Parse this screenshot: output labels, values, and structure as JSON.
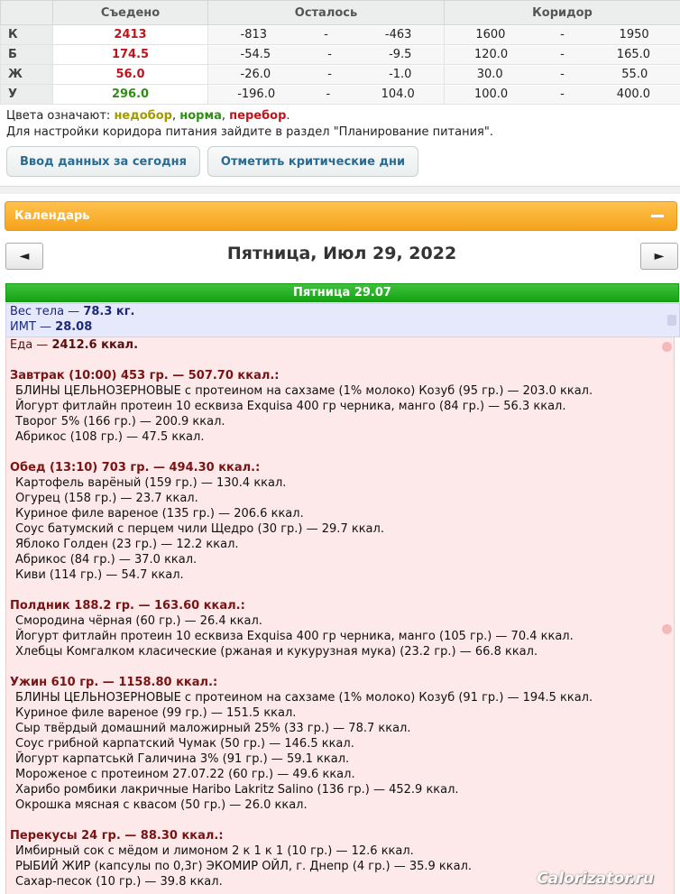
{
  "table": {
    "headers": [
      "",
      "Съедено",
      "Осталось",
      "Коридор"
    ],
    "rows": [
      {
        "label": "К",
        "eaten": "2413",
        "eaten_color": "#c0141c",
        "left_from": "-813",
        "left_to": "-463",
        "corr_from": "1600",
        "corr_to": "1950"
      },
      {
        "label": "Б",
        "eaten": "174.5",
        "eaten_color": "#c0141c",
        "left_from": "-54.5",
        "left_to": "-9.5",
        "corr_from": "120.0",
        "corr_to": "165.0"
      },
      {
        "label": "Ж",
        "eaten": "56.0",
        "eaten_color": "#c0141c",
        "left_from": "-26.0",
        "left_to": "-1.0",
        "corr_from": "30.0",
        "corr_to": "55.0"
      },
      {
        "label": "У",
        "eaten": "296.0",
        "eaten_color": "#2f8f14",
        "left_from": "-196.0",
        "left_to": "104.0",
        "corr_from": "100.0",
        "corr_to": "400.0"
      }
    ],
    "dash": "-"
  },
  "legend": {
    "prefix": "Цвета означают: ",
    "under": "недобор",
    "under_color": "#a39a00",
    "norm": "норма",
    "norm_color": "#2f8f14",
    "over": "перебор",
    "over_color": "#c0141c",
    "comma": ",",
    "dot": ".",
    "note": "Для настройки коридора питания зайдите в раздел \"Планирование питания\"."
  },
  "buttons": {
    "today": "Ввод данных за сегодня",
    "critical": "Отметить критические дни"
  },
  "calendar": {
    "title": "Календарь",
    "date": "Пятница, Июл 29, 2022",
    "prev": "◄",
    "next": "►",
    "day_bar": "Пятница 29.07"
  },
  "body": {
    "weight_label": "Вес тела — ",
    "weight": "78.3 кг.",
    "bmi_label": "ИМТ — ",
    "bmi": "28.08"
  },
  "food": {
    "total_label": "Еда — ",
    "total": "2412.6 ккал.",
    "meals": [
      {
        "title": "Завтрак (10:00) 453 гр. — 507.70 ккал.:",
        "items": [
          "БЛИНЫ ЦЕЛЬНОЗЕРНОВЫЕ с протеином на сахзаме (1% молоко) Козуб (95 гр.) — 203.0 ккал.",
          "Йогурт фитлайн протеин 10 есквиза Exquisa 400 гр черника, манго (84 гр.) — 56.3 ккал.",
          "Творог 5% (166 гр.) — 200.9 ккал.",
          "Абрикос (108 гр.) — 47.5 ккал."
        ]
      },
      {
        "title": "Обед (13:10) 703 гр. — 494.30 ккал.:",
        "items": [
          "Картофель варёный (159 гр.) — 130.4 ккал.",
          "Огурец (158 гр.) — 23.7 ккал.",
          "Куриное филе вареное (135 гр.) — 206.6 ккал.",
          "Соус батумский с перцем чили Щедро (30 гр.) — 29.7 ккал.",
          "Яблоко Голден (23 гр.) — 12.2 ккал.",
          "Абрикос (84 гр.) — 37.0 ккал.",
          "Киви (114 гр.) — 54.7 ккал."
        ]
      },
      {
        "title": "Полдник 188.2 гр. — 163.60 ккал.:",
        "items": [
          "Смородина чёрная (60 гр.) — 26.4 ккал.",
          "Йогурт фитлайн протеин 10 есквиза Exquisa 400 гр черника, манго (105 гр.) — 70.4 ккал.",
          "Хлебцы Комгалком класические (ржаная и кукурузная мука) (23.2 гр.) — 66.8 ккал."
        ]
      },
      {
        "title": "Ужин 610 гр. — 1158.80 ккал.:",
        "items": [
          "БЛИНЫ ЦЕЛЬНОЗЕРНОВЫЕ с протеином на сахзаме (1% молоко) Козуб (91 гр.) — 194.5 ккал.",
          "Куриное филе вареное (99 гр.) — 151.5 ккал.",
          "Сыр твёрдый домашний маложирный 25% (33 гр.) — 78.7 ккал.",
          "Соус грибной карпатский Чумак (50 гр.) — 146.5 ккал.",
          "Йогурт карпатськй Галичина 3% (91 гр.) — 59.1 ккал.",
          "Мороженое с протеином 27.07.22 (60 гр.) — 49.6 ккал.",
          "Харибо ромбики лакричные Haribo Lakritz Salino (136 гр.) — 452.9 ккал.",
          "Окрошка мясная с квасом (50 гр.) — 26.0 ккал."
        ]
      },
      {
        "title": "Перекусы 24 гр. — 88.30 ккал.:",
        "items": [
          "Имбирный сок с мёдом и лимоном 2 к 1 к 1 (10 гр.) — 12.6 ккал.",
          "РЫБИЙ ЖИР (капсулы по 0,3г) ЭКОМИР ОЙЛ, г. Днепр (4 гр.) — 35.9 ккал.",
          "Сахар-песок (10 гр.) — 39.8 ккал."
        ]
      }
    ]
  },
  "watermark": "Calorizator.ru"
}
